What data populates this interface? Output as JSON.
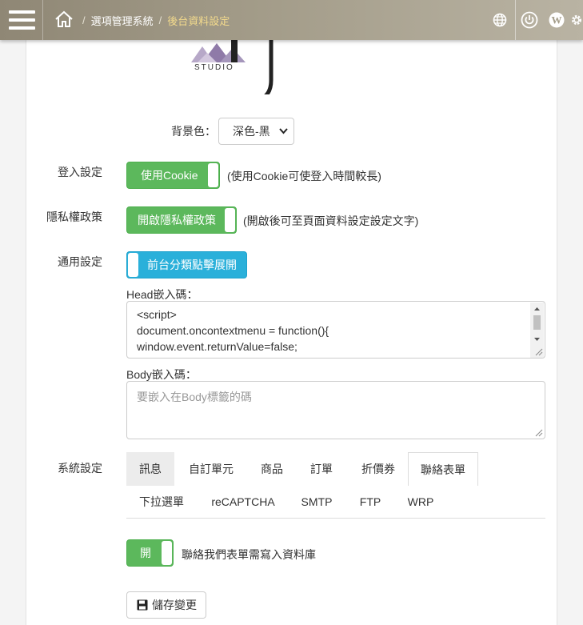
{
  "topbar": {
    "breadcrumb_root": "選項管理系統",
    "breadcrumb_sep": "/",
    "breadcrumb_current": "後台資料設定",
    "icons": [
      "menu-icon",
      "home-icon",
      "globe-icon",
      "power-icon",
      "wordpress-icon",
      "gear-icon"
    ]
  },
  "logo": {
    "text": "STUDIO"
  },
  "background": {
    "label": "背景色：",
    "selected": "深色-黑"
  },
  "login": {
    "label": "登入設定",
    "toggle": "使用Cookie",
    "note": "(使用Cookie可使登入時間較長)"
  },
  "privacy": {
    "label": "隱私權政策",
    "toggle": "開啟隱私權政策",
    "note": "(開啟後可至頁面資料設定設定文字)"
  },
  "general": {
    "label": "通用設定",
    "toggle": "前台分類點擊展開",
    "head_label": "Head嵌入碼：",
    "head_code": [
      "<script>",
      "document.oncontextmenu = function(){",
      "window.event.returnValue=false;"
    ],
    "body_label": "Body嵌入碼：",
    "body_placeholder": "要嵌入在Body標籤的碼"
  },
  "system": {
    "label": "系統設定",
    "tabs_row1": [
      "訊息",
      "自訂單元",
      "商品",
      "訂單",
      "折價券",
      "聯絡表單"
    ],
    "tabs_row2": [
      "下拉選單",
      "reCAPTCHA",
      "SMTP",
      "FTP",
      "WRP"
    ],
    "active_tab": "聯絡表單",
    "contact_toggle": "開",
    "contact_note": "聯絡我們表單需寫入資料庫"
  },
  "save_button": "儲存變更",
  "colors": {
    "green": "#5cb85c",
    "blue": "#2ab0da",
    "topbar": "#a39c89",
    "crumb_current": "#f3da8c"
  }
}
